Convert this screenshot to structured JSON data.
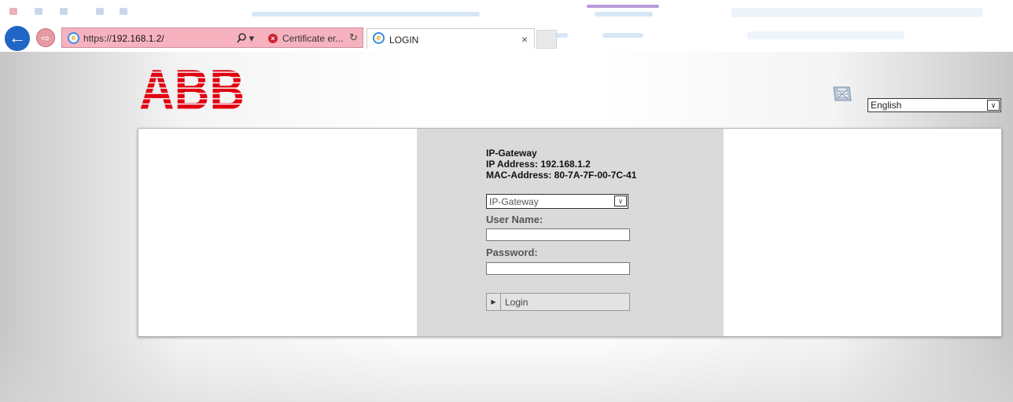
{
  "browser": {
    "url_prefix": "https://",
    "url_host": "192.168.1.2/",
    "search_icon": "magnifier-icon",
    "dropdown_glyph": "▾",
    "certificate_label": "Certificate er...",
    "tab_title": "LOGIN",
    "tab_close": "×",
    "back_glyph": "←",
    "forward_glyph": "⇨",
    "ie_glyph": "e",
    "refresh_glyph": "↻",
    "accent_color": "#1f66c7",
    "error_color": "#cc2233"
  },
  "header": {
    "brand": "ABB",
    "brand_color": "#e2000f",
    "language": {
      "selected": "English",
      "arrow": "∨"
    }
  },
  "login": {
    "device_name": "IP-Gateway",
    "ip_address_line": "IP Address: 192.168.1.2",
    "mac_address_line": "MAC-Address: 80-7A-7F-00-7C-41",
    "device_select": {
      "selected": "IP-Gateway",
      "arrow": "∨"
    },
    "username_label": "User Name:",
    "username_value": "",
    "password_label": "Password:",
    "password_value": "",
    "login_button": "Login",
    "login_arrow": "▶"
  }
}
